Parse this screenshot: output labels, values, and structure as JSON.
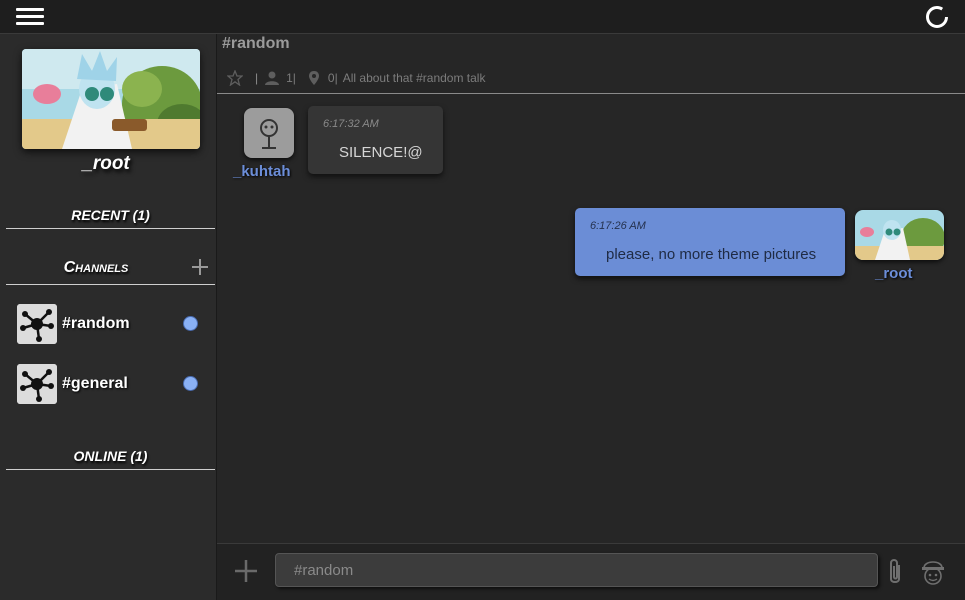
{
  "user": {
    "name": "_root"
  },
  "sidebar": {
    "recent_label": "RECENT (1)",
    "channels_label": "Channels",
    "online_label": "ONLINE (1)",
    "channels": [
      {
        "name": "#random"
      },
      {
        "name": "#general"
      }
    ]
  },
  "room": {
    "title": "#random",
    "members_count": "1|",
    "pins_count": "0|",
    "topic": "All about that #random talk"
  },
  "messages": [
    {
      "user": "_kuhtah",
      "time": "6:17:32 AM",
      "text": "SILENCE!@"
    },
    {
      "user": "_root",
      "time": "6:17:26 AM",
      "text": "please, no more theme pictures"
    }
  ],
  "composer": {
    "placeholder": "#random"
  },
  "colors": {
    "accent": "#6b8dd6",
    "online_dot": "#8ab1f5",
    "username": "#6c8ed9"
  }
}
